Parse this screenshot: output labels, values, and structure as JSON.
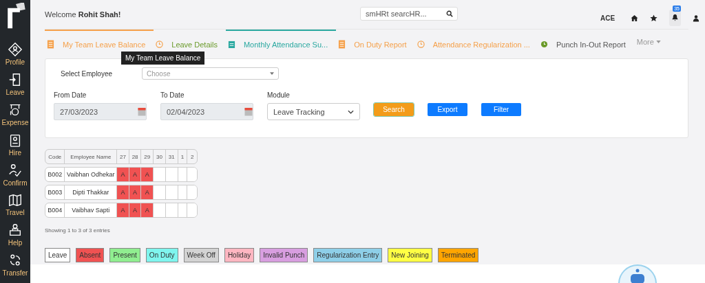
{
  "sidebar": {
    "items": [
      {
        "label": "Profile",
        "kind": "profile"
      },
      {
        "label": "Leave",
        "kind": "leave"
      },
      {
        "label": "Expense",
        "kind": "expense"
      },
      {
        "label": "Hire",
        "kind": "hire"
      },
      {
        "label": "Confirm",
        "kind": "confirm"
      },
      {
        "label": "Travel",
        "kind": "travel"
      },
      {
        "label": "Help",
        "kind": "help"
      },
      {
        "label": "Transfer",
        "kind": "transfer"
      }
    ]
  },
  "header": {
    "welcome": "Welcome",
    "user": "Rohit Shah!",
    "search": {
      "placeholder": "smHRt searcHR..."
    },
    "company": "ACE",
    "notifications": "35"
  },
  "tabs": [
    {
      "label": "My Team Leave Balance",
      "kind": "list",
      "color": "#f5a04a",
      "selected": true
    },
    {
      "label": "Leave Details",
      "kind": "clock",
      "color": "#6a9a2a",
      "selected": false
    },
    {
      "label": "Monthly Attendance Su...",
      "kind": "calendar",
      "color": "#2aa8a0",
      "selected": true
    },
    {
      "label": "On Duty Report",
      "kind": "list",
      "color": "#f5a04a",
      "selected": false
    },
    {
      "label": "Attendance Regularization ...",
      "kind": "clock",
      "color": "#f5a04a",
      "selected": false
    },
    {
      "label": "Punch In-Out Report",
      "kind": "punch",
      "color": "#555555",
      "selected": false
    }
  ],
  "more": "More",
  "tooltip": "My Team Leave Balance",
  "filters": {
    "employee_label": "Select Employee",
    "employee": {
      "placeholder": "Choose"
    },
    "from_label": "From Date",
    "from": "27/03/2023",
    "to_label": "To Date",
    "to": "02/04/2023",
    "module_label": "Module",
    "module": "Leave Tracking",
    "buttons": [
      {
        "label": "Search",
        "kind": "primary"
      },
      {
        "label": "Export",
        "kind": "secondary"
      },
      {
        "label": "Filter",
        "kind": "secondary"
      }
    ]
  },
  "table": {
    "columns": [
      "Code",
      "Employee Name",
      "27",
      "28",
      "29",
      "30",
      "31",
      "1",
      "2"
    ],
    "rows": [
      {
        "code": "B002",
        "name": "Vaibhan Odhekar",
        "days": [
          {
            "kind": "absent",
            "text": "A"
          },
          {
            "kind": "absent",
            "text": "A"
          },
          {
            "kind": "absent",
            "text": "A"
          },
          {
            "kind": "empty"
          },
          {
            "kind": "empty"
          },
          {
            "kind": "empty"
          },
          {
            "kind": "empty"
          }
        ]
      },
      {
        "code": "B003",
        "name": "Dipti Thakkar",
        "days": [
          {
            "kind": "absent",
            "text": "A"
          },
          {
            "kind": "absent",
            "text": "A"
          },
          {
            "kind": "absent",
            "text": "A"
          },
          {
            "kind": "empty"
          },
          {
            "kind": "empty"
          },
          {
            "kind": "empty"
          },
          {
            "kind": "empty"
          }
        ]
      },
      {
        "code": "B004",
        "name": "Vaibhav Sapti",
        "days": [
          {
            "kind": "absent",
            "text": "A"
          },
          {
            "kind": "absent",
            "text": "A"
          },
          {
            "kind": "absent",
            "text": "A"
          },
          {
            "kind": "empty"
          },
          {
            "kind": "empty"
          },
          {
            "kind": "empty"
          },
          {
            "kind": "empty"
          }
        ]
      }
    ],
    "info": "Showing 1 to 3 of 3 entries"
  },
  "legend": [
    {
      "label": "Leave",
      "color": "#ffffff"
    },
    {
      "label": "Absent",
      "color": "#f05252"
    },
    {
      "label": "Present",
      "color": "#90ee90"
    },
    {
      "label": "On Duty",
      "color": "#7ff5ee"
    },
    {
      "label": "Week Off",
      "color": "#d3d3d3"
    },
    {
      "label": "Holiday",
      "color": "#ffb6c1"
    },
    {
      "label": "Invalid Punch",
      "color": "#d89ee0"
    },
    {
      "label": "Regularization Entry",
      "color": "#8ecfe8"
    },
    {
      "label": "New Joining",
      "color": "#ffff44"
    },
    {
      "label": "Terminated",
      "color": "#ffa500"
    }
  ]
}
